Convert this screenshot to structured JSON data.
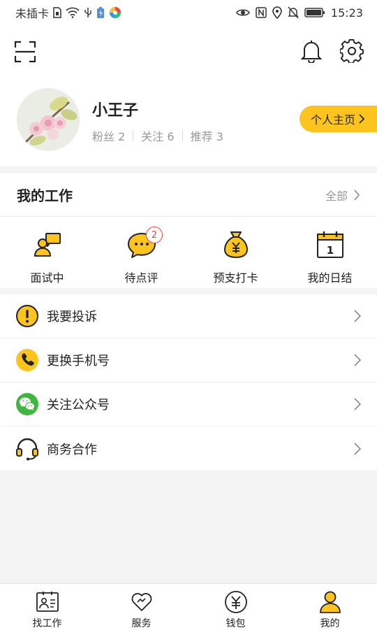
{
  "status_bar": {
    "carrier": "未插卡",
    "time": "15:23"
  },
  "profile": {
    "name": "小王子",
    "stats": [
      {
        "label": "粉丝",
        "count": "2"
      },
      {
        "label": "关注",
        "count": "6"
      },
      {
        "label": "推荐",
        "count": "3"
      }
    ],
    "homepage_label": "个人主页"
  },
  "work": {
    "title": "我的工作",
    "all_label": "全部",
    "items": [
      {
        "label": "面试中",
        "icon": "interview-icon"
      },
      {
        "label": "待点评",
        "icon": "chat-bubble-icon",
        "badge": "2"
      },
      {
        "label": "预支打卡",
        "icon": "money-bag-icon"
      },
      {
        "label": "我的日结",
        "icon": "calendar-icon",
        "calendar_day": "1"
      }
    ]
  },
  "menu": [
    {
      "label": "我要投诉",
      "icon": "warning-icon",
      "color": "#fcc41d"
    },
    {
      "label": "更换手机号",
      "icon": "phone-icon",
      "color": "#fcc41d"
    },
    {
      "label": "关注公众号",
      "icon": "wechat-icon",
      "color": "#3fb63f"
    },
    {
      "label": "商务合作",
      "icon": "headset-icon",
      "color": "#fcc41d"
    }
  ],
  "tabs": [
    {
      "label": "找工作",
      "icon": "id-card-icon",
      "active": false
    },
    {
      "label": "服务",
      "icon": "heart-icon",
      "active": false
    },
    {
      "label": "钱包",
      "icon": "yuan-coin-icon",
      "active": false
    },
    {
      "label": "我的",
      "icon": "person-icon",
      "active": true
    }
  ],
  "colors": {
    "accent": "#fcc41d",
    "badge": "#e44444",
    "wechat": "#3fb63f"
  }
}
